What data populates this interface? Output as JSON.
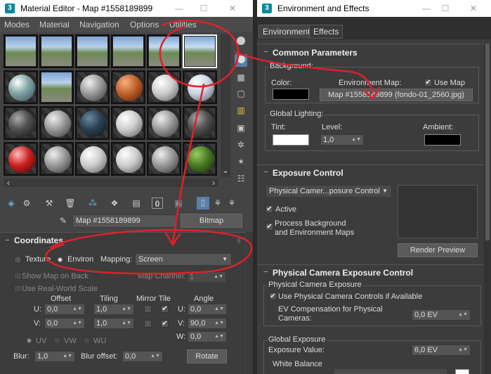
{
  "material_editor": {
    "title": "Material Editor - Map #1558189899",
    "menus": [
      "Modes",
      "Material",
      "Navigation",
      "Options",
      "Utilities"
    ],
    "map_name": "Map #1558189899",
    "map_type": "Bitmap",
    "coordinates_title": "Coordinates",
    "texture_label": "Texture",
    "environ_label": "Environ",
    "mapping_label": "Mapping:",
    "mapping_value": "Screen",
    "show_map_label": "Show Map on Back",
    "map_channel_label": "Map Channel:",
    "map_channel_value": "1",
    "real_world_label": "Use Real-World Scale",
    "offset_label": "Offset",
    "tiling_label": "Tiling",
    "mirror_tile_label": "Mirror Tile",
    "angle_label": "Angle",
    "u_label": "U:",
    "v_label": "V:",
    "w_label": "W:",
    "offset_u": "0,0",
    "offset_v": "0,0",
    "tiling_u": "1,0",
    "tiling_v": "1,0",
    "angle_u": "0,0",
    "angle_v": "90,0",
    "angle_w": "0,0",
    "uv_label": "UV",
    "vw_label": "VW",
    "wu_label": "WU",
    "blur_label": "Blur:",
    "blur_value": "1,0",
    "blur_offset_label": "Blur offset:",
    "blur_offset_value": "0,0",
    "rotate_label": "Rotate",
    "slots": [
      {
        "kind": "landscape"
      },
      {
        "kind": "landscape"
      },
      {
        "kind": "landscape"
      },
      {
        "kind": "landscape"
      },
      {
        "kind": "landscape-sel"
      },
      {
        "kind": "landscape-sel"
      },
      {
        "kind": "chrome"
      },
      {
        "kind": "landscape"
      },
      {
        "kind": "grey"
      },
      {
        "kind": "orange"
      },
      {
        "kind": "light"
      },
      {
        "kind": "light-blue"
      },
      {
        "kind": "dark"
      },
      {
        "kind": "grey"
      },
      {
        "kind": "navy"
      },
      {
        "kind": "light"
      },
      {
        "kind": "grey"
      },
      {
        "kind": "dark"
      },
      {
        "kind": "red"
      },
      {
        "kind": "grey"
      },
      {
        "kind": "light"
      },
      {
        "kind": "light"
      },
      {
        "kind": "grey"
      },
      {
        "kind": "green"
      }
    ]
  },
  "env": {
    "title": "Environment and Effects",
    "tab_environment": "Environment",
    "tab_effects": "Effects",
    "common_title": "Common Parameters",
    "background_label": "Background:",
    "color_label": "Color:",
    "env_map_label": "Environment Map:",
    "use_map_label": "Use Map",
    "env_map_button": "Map #1558189899 (fondo-01_2560.jpg)",
    "global_lighting_label": "Global Lighting:",
    "tint_label": "Tint:",
    "level_label": "Level:",
    "level_value": "1,0",
    "ambient_label": "Ambient:",
    "exposure_title": "Exposure Control",
    "exposure_value": "Physical Camer...posure Control",
    "active_label": "Active",
    "process_bg_label_1": "Process Background",
    "process_bg_label_2": "and Environment Maps",
    "render_preview": "Render Preview",
    "pce_title": "Physical Camera Exposure Control",
    "pce_group": "Physical Camera Exposure",
    "use_phys_label": "Use Physical Camera Controls if Available",
    "ev_comp_label_1": "EV Compensation for Physical",
    "ev_comp_label_2": "Cameras:",
    "ev_comp_value": "0,0 EV",
    "global_exposure_label": "Global Exposure",
    "exposure_value_label": "Exposure Value:",
    "exposure_value_value": "6,0 EV",
    "white_balance_label": "White Balance"
  },
  "colors": {
    "annotation": "#e0202a",
    "accent": "#0a8a9c",
    "highlight": "#5a7fa8"
  }
}
